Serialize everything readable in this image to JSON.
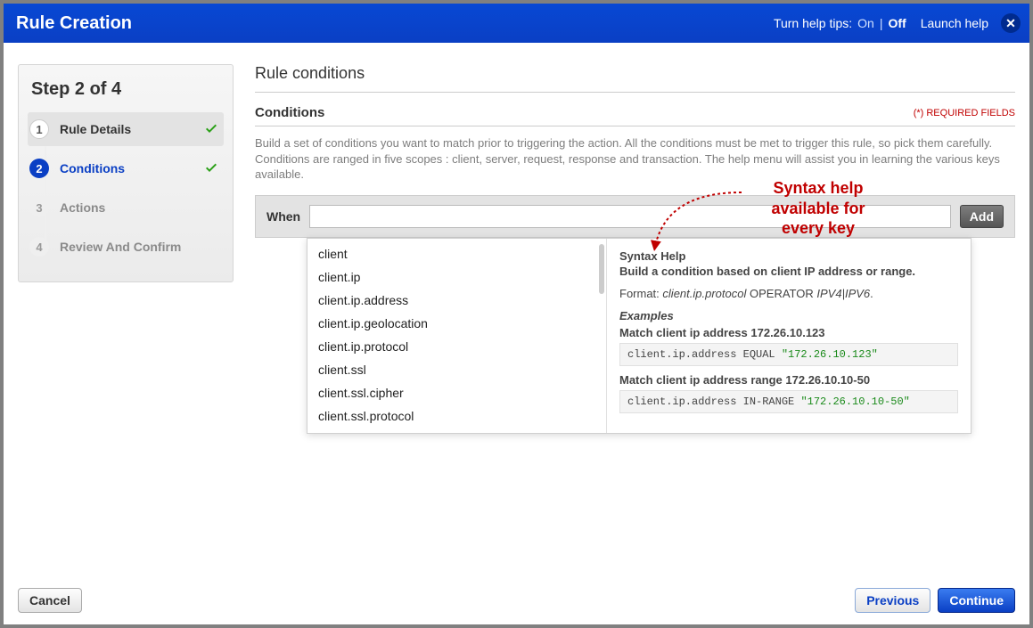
{
  "header": {
    "title": "Rule Creation",
    "help_prefix": "Turn help tips:",
    "help_on": "On",
    "help_off": "Off",
    "launch_help": "Launch help"
  },
  "sidebar": {
    "step_heading": "Step 2 of 4",
    "steps": [
      {
        "num": "1",
        "label": "Rule Details",
        "state": "done"
      },
      {
        "num": "2",
        "label": "Conditions",
        "state": "active"
      },
      {
        "num": "3",
        "label": "Actions",
        "state": "future"
      },
      {
        "num": "4",
        "label": "Review And Confirm",
        "state": "future"
      }
    ]
  },
  "main": {
    "page_title": "Rule conditions",
    "section_title": "Conditions",
    "required_note": "(*) REQUIRED FIELDS",
    "description": "Build a set of conditions you want to match prior to triggering the action. All the conditions must be met to trigger this rule, so pick them carefully. Conditions are ranged in five scopes : client, server, request, response and transaction. The help menu will assist you in learning the various keys available.",
    "when_label": "When",
    "add_label": "Add"
  },
  "options": [
    "client",
    "client.ip",
    "client.ip.address",
    "client.ip.geolocation",
    "client.ip.protocol",
    "client.ssl",
    "client.ssl.cipher",
    "client.ssl.protocol"
  ],
  "syntax_help": {
    "title": "Syntax Help",
    "desc": "Build a condition based on client IP address or range.",
    "format_prefix": "Format:",
    "format_expr": "client.ip.protocol",
    "format_op": "OPERATOR",
    "format_suffix": "IPV4|IPV6",
    "examples_heading": "Examples",
    "ex1_label": "Match client ip address 172.26.10.123",
    "ex1_code_pre": "client.ip.address EQUAL ",
    "ex1_code_str": "\"172.26.10.123\"",
    "ex2_label": "Match client ip address range 172.26.10.10-50",
    "ex2_code_pre": "client.ip.address IN-RANGE ",
    "ex2_code_str": "\"172.26.10.10-50\""
  },
  "annotation": {
    "line1": "Syntax help",
    "line2": "available for",
    "line3": "every key"
  },
  "footer": {
    "cancel": "Cancel",
    "previous": "Previous",
    "cont": "Continue"
  }
}
